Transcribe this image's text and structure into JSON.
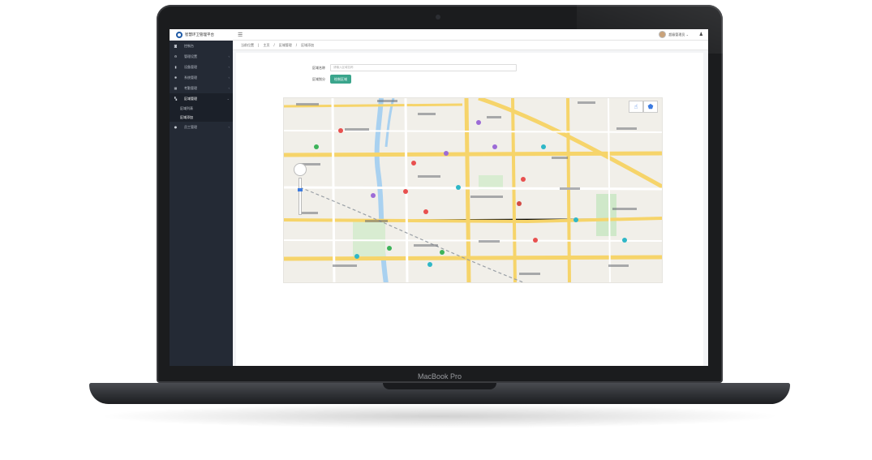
{
  "device": {
    "brand": "MacBook Pro"
  },
  "app": {
    "title": "智慧环卫管理平台"
  },
  "header": {
    "user_name": "超级管理员"
  },
  "sidebar": {
    "items": [
      {
        "label": "控制台",
        "icon": "dashboard-icon"
      },
      {
        "label": "管理设置",
        "icon": "gears-icon"
      },
      {
        "label": "设备管理",
        "icon": "chart-icon"
      },
      {
        "label": "系统管理",
        "icon": "gear-icon"
      },
      {
        "label": "考勤管理",
        "icon": "calendar-icon"
      },
      {
        "label": "区域管理",
        "icon": "map-icon"
      },
      {
        "label": "员工管理",
        "icon": "user-icon"
      }
    ],
    "subitems": [
      "区域列表",
      "区域添加"
    ]
  },
  "breadcrumb": {
    "prefix": "当前位置",
    "items": [
      "主页",
      "区域管理",
      "区域添加"
    ]
  },
  "form": {
    "name_label": "区域名称",
    "name_placeholder": "请输入区域名称",
    "draw_label": "区域划分",
    "draw_button": "绘制区域"
  },
  "colors": {
    "accent": "#3aa58c",
    "sidebar_bg": "#242a35"
  }
}
